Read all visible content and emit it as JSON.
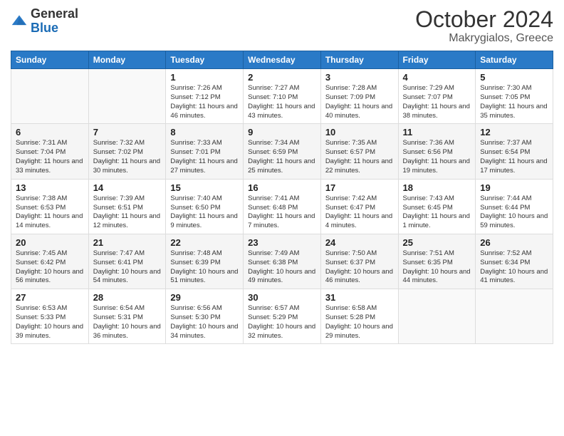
{
  "header": {
    "logo": {
      "general": "General",
      "blue": "Blue"
    },
    "month_title": "October 2024",
    "location": "Makrygialos, Greece"
  },
  "weekdays": [
    "Sunday",
    "Monday",
    "Tuesday",
    "Wednesday",
    "Thursday",
    "Friday",
    "Saturday"
  ],
  "weeks": [
    [
      {
        "day": "",
        "sunrise": "",
        "sunset": "",
        "daylight": ""
      },
      {
        "day": "",
        "sunrise": "",
        "sunset": "",
        "daylight": ""
      },
      {
        "day": "1",
        "sunrise": "Sunrise: 7:26 AM",
        "sunset": "Sunset: 7:12 PM",
        "daylight": "Daylight: 11 hours and 46 minutes."
      },
      {
        "day": "2",
        "sunrise": "Sunrise: 7:27 AM",
        "sunset": "Sunset: 7:10 PM",
        "daylight": "Daylight: 11 hours and 43 minutes."
      },
      {
        "day": "3",
        "sunrise": "Sunrise: 7:28 AM",
        "sunset": "Sunset: 7:09 PM",
        "daylight": "Daylight: 11 hours and 40 minutes."
      },
      {
        "day": "4",
        "sunrise": "Sunrise: 7:29 AM",
        "sunset": "Sunset: 7:07 PM",
        "daylight": "Daylight: 11 hours and 38 minutes."
      },
      {
        "day": "5",
        "sunrise": "Sunrise: 7:30 AM",
        "sunset": "Sunset: 7:05 PM",
        "daylight": "Daylight: 11 hours and 35 minutes."
      }
    ],
    [
      {
        "day": "6",
        "sunrise": "Sunrise: 7:31 AM",
        "sunset": "Sunset: 7:04 PM",
        "daylight": "Daylight: 11 hours and 33 minutes."
      },
      {
        "day": "7",
        "sunrise": "Sunrise: 7:32 AM",
        "sunset": "Sunset: 7:02 PM",
        "daylight": "Daylight: 11 hours and 30 minutes."
      },
      {
        "day": "8",
        "sunrise": "Sunrise: 7:33 AM",
        "sunset": "Sunset: 7:01 PM",
        "daylight": "Daylight: 11 hours and 27 minutes."
      },
      {
        "day": "9",
        "sunrise": "Sunrise: 7:34 AM",
        "sunset": "Sunset: 6:59 PM",
        "daylight": "Daylight: 11 hours and 25 minutes."
      },
      {
        "day": "10",
        "sunrise": "Sunrise: 7:35 AM",
        "sunset": "Sunset: 6:57 PM",
        "daylight": "Daylight: 11 hours and 22 minutes."
      },
      {
        "day": "11",
        "sunrise": "Sunrise: 7:36 AM",
        "sunset": "Sunset: 6:56 PM",
        "daylight": "Daylight: 11 hours and 19 minutes."
      },
      {
        "day": "12",
        "sunrise": "Sunrise: 7:37 AM",
        "sunset": "Sunset: 6:54 PM",
        "daylight": "Daylight: 11 hours and 17 minutes."
      }
    ],
    [
      {
        "day": "13",
        "sunrise": "Sunrise: 7:38 AM",
        "sunset": "Sunset: 6:53 PM",
        "daylight": "Daylight: 11 hours and 14 minutes."
      },
      {
        "day": "14",
        "sunrise": "Sunrise: 7:39 AM",
        "sunset": "Sunset: 6:51 PM",
        "daylight": "Daylight: 11 hours and 12 minutes."
      },
      {
        "day": "15",
        "sunrise": "Sunrise: 7:40 AM",
        "sunset": "Sunset: 6:50 PM",
        "daylight": "Daylight: 11 hours and 9 minutes."
      },
      {
        "day": "16",
        "sunrise": "Sunrise: 7:41 AM",
        "sunset": "Sunset: 6:48 PM",
        "daylight": "Daylight: 11 hours and 7 minutes."
      },
      {
        "day": "17",
        "sunrise": "Sunrise: 7:42 AM",
        "sunset": "Sunset: 6:47 PM",
        "daylight": "Daylight: 11 hours and 4 minutes."
      },
      {
        "day": "18",
        "sunrise": "Sunrise: 7:43 AM",
        "sunset": "Sunset: 6:45 PM",
        "daylight": "Daylight: 11 hours and 1 minute."
      },
      {
        "day": "19",
        "sunrise": "Sunrise: 7:44 AM",
        "sunset": "Sunset: 6:44 PM",
        "daylight": "Daylight: 10 hours and 59 minutes."
      }
    ],
    [
      {
        "day": "20",
        "sunrise": "Sunrise: 7:45 AM",
        "sunset": "Sunset: 6:42 PM",
        "daylight": "Daylight: 10 hours and 56 minutes."
      },
      {
        "day": "21",
        "sunrise": "Sunrise: 7:47 AM",
        "sunset": "Sunset: 6:41 PM",
        "daylight": "Daylight: 10 hours and 54 minutes."
      },
      {
        "day": "22",
        "sunrise": "Sunrise: 7:48 AM",
        "sunset": "Sunset: 6:39 PM",
        "daylight": "Daylight: 10 hours and 51 minutes."
      },
      {
        "day": "23",
        "sunrise": "Sunrise: 7:49 AM",
        "sunset": "Sunset: 6:38 PM",
        "daylight": "Daylight: 10 hours and 49 minutes."
      },
      {
        "day": "24",
        "sunrise": "Sunrise: 7:50 AM",
        "sunset": "Sunset: 6:37 PM",
        "daylight": "Daylight: 10 hours and 46 minutes."
      },
      {
        "day": "25",
        "sunrise": "Sunrise: 7:51 AM",
        "sunset": "Sunset: 6:35 PM",
        "daylight": "Daylight: 10 hours and 44 minutes."
      },
      {
        "day": "26",
        "sunrise": "Sunrise: 7:52 AM",
        "sunset": "Sunset: 6:34 PM",
        "daylight": "Daylight: 10 hours and 41 minutes."
      }
    ],
    [
      {
        "day": "27",
        "sunrise": "Sunrise: 6:53 AM",
        "sunset": "Sunset: 5:33 PM",
        "daylight": "Daylight: 10 hours and 39 minutes."
      },
      {
        "day": "28",
        "sunrise": "Sunrise: 6:54 AM",
        "sunset": "Sunset: 5:31 PM",
        "daylight": "Daylight: 10 hours and 36 minutes."
      },
      {
        "day": "29",
        "sunrise": "Sunrise: 6:56 AM",
        "sunset": "Sunset: 5:30 PM",
        "daylight": "Daylight: 10 hours and 34 minutes."
      },
      {
        "day": "30",
        "sunrise": "Sunrise: 6:57 AM",
        "sunset": "Sunset: 5:29 PM",
        "daylight": "Daylight: 10 hours and 32 minutes."
      },
      {
        "day": "31",
        "sunrise": "Sunrise: 6:58 AM",
        "sunset": "Sunset: 5:28 PM",
        "daylight": "Daylight: 10 hours and 29 minutes."
      },
      {
        "day": "",
        "sunrise": "",
        "sunset": "",
        "daylight": ""
      },
      {
        "day": "",
        "sunrise": "",
        "sunset": "",
        "daylight": ""
      }
    ]
  ]
}
